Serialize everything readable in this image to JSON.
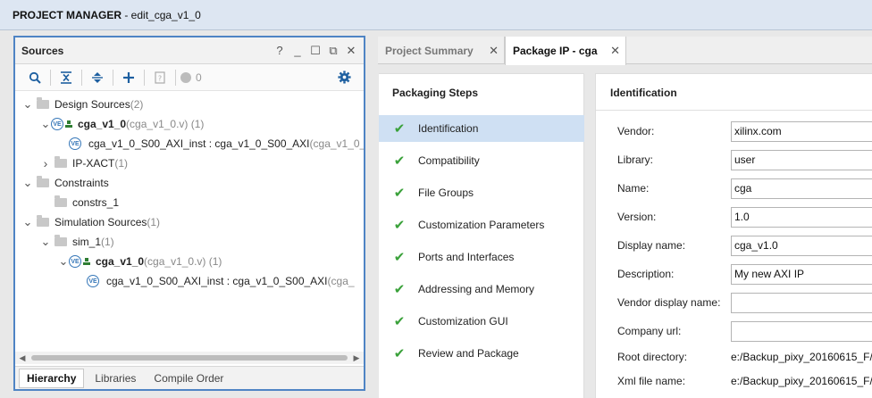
{
  "window": {
    "title_prefix": "PROJECT MANAGER",
    "title_suffix": " - edit_cga_v1_0"
  },
  "sources": {
    "title": "Sources",
    "header_controls": [
      "?",
      "_",
      "☐",
      "⧉",
      "✕"
    ],
    "badge_count": "0",
    "tree": [
      {
        "indent": 0,
        "chev": "v",
        "icon": "folder",
        "label": "Design Sources",
        "meta": " (2)",
        "bold": false
      },
      {
        "indent": 1,
        "chev": "v",
        "icon": "ve",
        "label": "cga_v1_0",
        "meta": " (cga_v1_0.v) (1)",
        "bold": true
      },
      {
        "indent": 2,
        "chev": "",
        "icon": "ve-only",
        "label": "cga_v1_0_S00_AXI_inst : cga_v1_0_S00_AXI",
        "meta": " (cga_v1_0_",
        "bold": false
      },
      {
        "indent": 1,
        "chev": ">",
        "icon": "folder",
        "label": "IP-XACT",
        "meta": " (1)",
        "bold": false
      },
      {
        "indent": 0,
        "chev": "v",
        "icon": "folder",
        "label": "Constraints",
        "meta": "",
        "bold": false
      },
      {
        "indent": 1,
        "chev": "",
        "icon": "folder",
        "label": "constrs_1",
        "meta": "",
        "bold": false
      },
      {
        "indent": 0,
        "chev": "v",
        "icon": "folder",
        "label": "Simulation Sources",
        "meta": " (1)",
        "bold": false
      },
      {
        "indent": 1,
        "chev": "v",
        "icon": "folder",
        "label": "sim_1",
        "meta": " (1)",
        "bold": false
      },
      {
        "indent": 2,
        "chev": "v",
        "icon": "ve",
        "label": "cga_v1_0",
        "meta": " (cga_v1_0.v) (1)",
        "bold": true
      },
      {
        "indent": 3,
        "chev": "",
        "icon": "ve-only",
        "label": "cga_v1_0_S00_AXI_inst : cga_v1_0_S00_AXI",
        "meta": " (cga_",
        "bold": false
      }
    ],
    "bottom_tabs": [
      "Hierarchy",
      "Libraries",
      "Compile Order"
    ]
  },
  "tabs": [
    {
      "label": "Project Summary",
      "close": "✕"
    },
    {
      "label": "Package IP - cga",
      "close": "✕"
    }
  ],
  "steps": {
    "title": "Packaging Steps",
    "items": [
      "Identification",
      "Compatibility",
      "File Groups",
      "Customization Parameters",
      "Ports and Interfaces",
      "Addressing and Memory",
      "Customization GUI",
      "Review and Package"
    ]
  },
  "identification": {
    "title": "Identification",
    "fields": [
      {
        "label": "Vendor:",
        "value": "xilinx.com"
      },
      {
        "label": "Library:",
        "value": "user"
      },
      {
        "label": "Name:",
        "value": "cga"
      },
      {
        "label": "Version:",
        "value": "1.0"
      },
      {
        "label": "Display name:",
        "value": "cga_v1.0"
      },
      {
        "label": "Description:",
        "value": "My new AXI IP"
      },
      {
        "label": "Vendor display name:",
        "value": ""
      },
      {
        "label": "Company url:",
        "value": ""
      }
    ],
    "readonly": [
      {
        "label": "Root directory:",
        "value": "e:/Backup_pixy_20160615_F/"
      },
      {
        "label": "Xml file name:",
        "value": "e:/Backup_pixy_20160615_F/"
      }
    ]
  }
}
